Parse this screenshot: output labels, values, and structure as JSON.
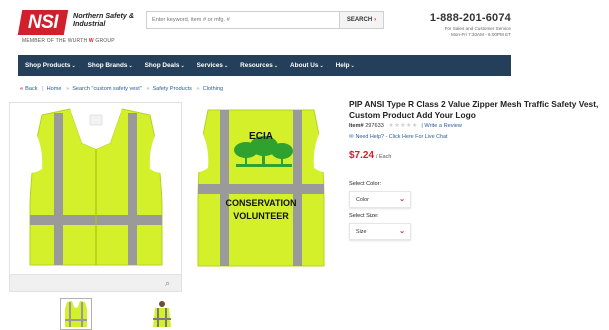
{
  "header": {
    "logo_text": "NSI",
    "logo_name": "Northern Safety & Industrial",
    "logo_tagline_prefix": "MEMBER OF THE WURTH",
    "logo_tagline_brand": "W",
    "logo_tagline_suffix": "GROUP",
    "search_placeholder": "Enter keyword, item # or mfg. #",
    "search_button": "SEARCH",
    "phone": "1-888-201-6074",
    "hours_line1": "For Sales and Customer Service",
    "hours_line2": "Mon-Fri 7:30AM - 6:00PM ET"
  },
  "nav": {
    "items": [
      "Shop Products",
      "Shop Brands",
      "Shop Deals",
      "Services",
      "Resources",
      "About Us",
      "Help"
    ]
  },
  "breadcrumb": {
    "back": "Back",
    "items": [
      "Home",
      "Search \"custom safety vest\"",
      "Safety Products",
      "Clothing"
    ]
  },
  "images": {
    "back_print_top": "ECIA",
    "back_print_line1": "CONSERVATION",
    "back_print_line2": "VOLUNTEER"
  },
  "product": {
    "title": "PIP ANSI Type R Class 2 Value Zipper Mesh Traffic Safety Vest, Custom Product Add Your Logo",
    "item_label": "Item#",
    "item_number": "297633",
    "stars": "★★★★★",
    "review_link": "| Write a Review",
    "help_text": "Need Help? - Click Here For Live Chat",
    "price": "$7.24",
    "unit": "/ Each",
    "color_label": "Select Color:",
    "color_value": "Color",
    "size_label": "Select Size:",
    "size_value": "Size"
  },
  "colors": {
    "brand_red": "#d11f2b",
    "nav_bg": "#243f5a",
    "vest_yellow": "#d4f02a",
    "reflective_gray": "#9a9a9a",
    "tree_green": "#2ea12f"
  }
}
